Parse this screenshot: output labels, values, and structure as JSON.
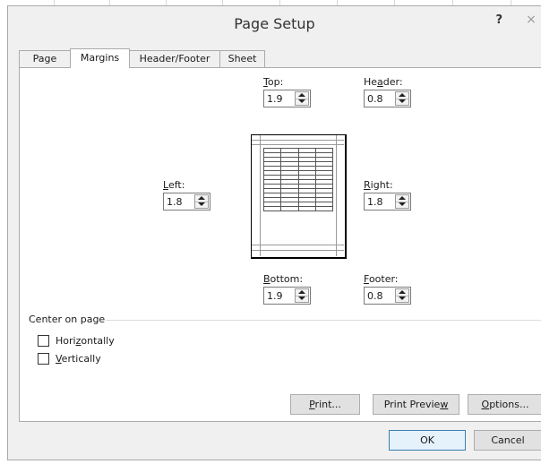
{
  "dialog": {
    "title": "Page Setup",
    "help_label": "?",
    "close_label": "×"
  },
  "tabs": [
    {
      "label": "Page"
    },
    {
      "label": "Margins",
      "active": true
    },
    {
      "label": "Header/Footer"
    },
    {
      "label": "Sheet"
    }
  ],
  "margins": {
    "top": {
      "label_u": "T",
      "label_rest": "op:",
      "value": "1.9"
    },
    "header": {
      "label_pre": "He",
      "label_u": "a",
      "label_rest": "der:",
      "value": "0.8"
    },
    "left": {
      "label_u": "L",
      "label_rest": "eft:",
      "value": "1.8"
    },
    "right": {
      "label_u": "R",
      "label_rest": "ight:",
      "value": "1.8"
    },
    "bottom": {
      "label_u": "B",
      "label_rest": "ottom:",
      "value": "1.9"
    },
    "footer": {
      "label_u": "F",
      "label_rest": "ooter:",
      "value": "0.8"
    }
  },
  "center_on_page": {
    "group_label": "Center on page",
    "horizontally": {
      "label_pre": "Hori",
      "label_u": "z",
      "label_rest": "ontally",
      "checked": false
    },
    "vertically": {
      "label_u": "V",
      "label_rest": "ertically",
      "checked": false
    }
  },
  "buttons": {
    "print": {
      "label_u": "P",
      "label_rest": "rint..."
    },
    "print_preview": {
      "label_pre": "Print Previe",
      "label_u": "w"
    },
    "options": {
      "label_u": "O",
      "label_rest": "ptions..."
    },
    "ok": "OK",
    "cancel": "Cancel"
  },
  "colors": {
    "dialog_bg": "#f0f0f0",
    "panel_bg": "#ffffff",
    "default_button_border": "#3c7fb1"
  },
  "icons": {
    "spin_up": "triangle-up",
    "spin_down": "triangle-down",
    "close": "x-mark"
  }
}
